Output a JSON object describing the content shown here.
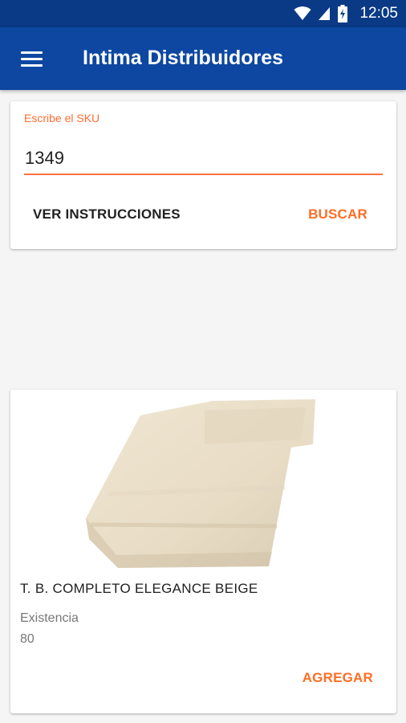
{
  "status_bar": {
    "time": "12:05",
    "icons": [
      "wifi-icon",
      "signal-icon",
      "battery-icon"
    ]
  },
  "app_bar": {
    "title": "Intima Distribuidores",
    "menu_icon": "menu-icon"
  },
  "search": {
    "label": "Escribe el SKU",
    "value": "1349",
    "instructions_label": "VER INSTRUCCIONES",
    "search_label": "BUSCAR"
  },
  "product": {
    "name": "T. B. COMPLETO ELEGANCE BEIGE",
    "stock_label": "Existencia",
    "stock_value": "80",
    "add_label": "AGREGAR",
    "image": "beige-towel-image"
  },
  "colors": {
    "primary": "#0d47a1",
    "status_bar": "#0a3a86",
    "accent": "#ff6d24",
    "background": "#f5f5f5"
  }
}
